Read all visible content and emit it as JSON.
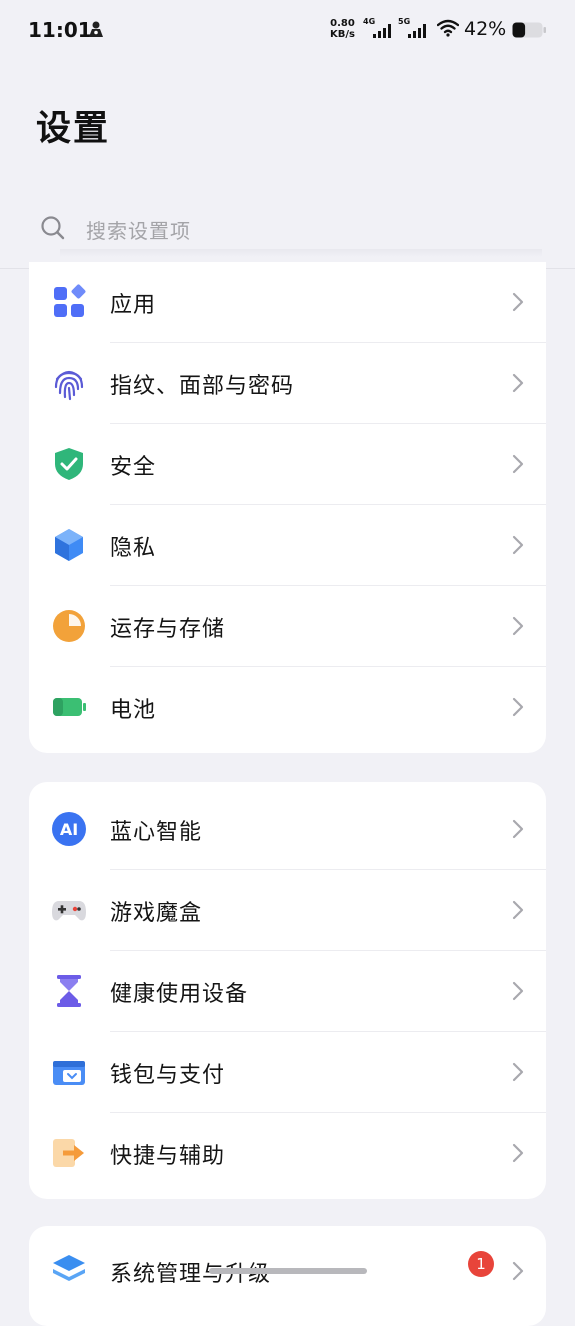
{
  "status_bar": {
    "time": "11:01",
    "net_speed_value": "0.80",
    "net_speed_unit": "KB/s",
    "signal_1": "4G",
    "signal_2": "5G",
    "battery_percent": "42%",
    "battery_level": 0.42
  },
  "page": {
    "title": "设置"
  },
  "search": {
    "placeholder": "搜索设置项"
  },
  "groups": [
    {
      "items": [
        {
          "label": "应用",
          "icon": "apps-icon"
        },
        {
          "label": "指纹、面部与密码",
          "icon": "fingerprint-icon"
        },
        {
          "label": "安全",
          "icon": "shield-icon"
        },
        {
          "label": "隐私",
          "icon": "privacy-cube-icon"
        },
        {
          "label": "运存与存储",
          "icon": "storage-pie-icon"
        },
        {
          "label": "电池",
          "icon": "battery-icon"
        }
      ]
    },
    {
      "items": [
        {
          "label": "蓝心智能",
          "icon": "ai-icon",
          "icon_text": "AI"
        },
        {
          "label": "游戏魔盒",
          "icon": "gamepad-icon"
        },
        {
          "label": "健康使用设备",
          "icon": "hourglass-icon"
        },
        {
          "label": "钱包与支付",
          "icon": "wallet-icon"
        },
        {
          "label": "快捷与辅助",
          "icon": "shortcut-icon"
        }
      ]
    },
    {
      "items": [
        {
          "label": "系统管理与升级",
          "icon": "system-layers-icon",
          "badge": "1"
        }
      ]
    }
  ],
  "colors": {
    "background": "#f1f1f6",
    "apps": "#4f6ef7",
    "fingerprint": "#5b5bd6",
    "shield": "#2fb67a",
    "privacy": "#3f8bf5",
    "storage": "#f2a23a",
    "battery": "#3bbf73",
    "ai": "#3a73f1",
    "hourglass": "#6c5ce7",
    "wallet": "#4a8df5",
    "shortcut": "#f59b3a",
    "badge": "#e8443a"
  }
}
